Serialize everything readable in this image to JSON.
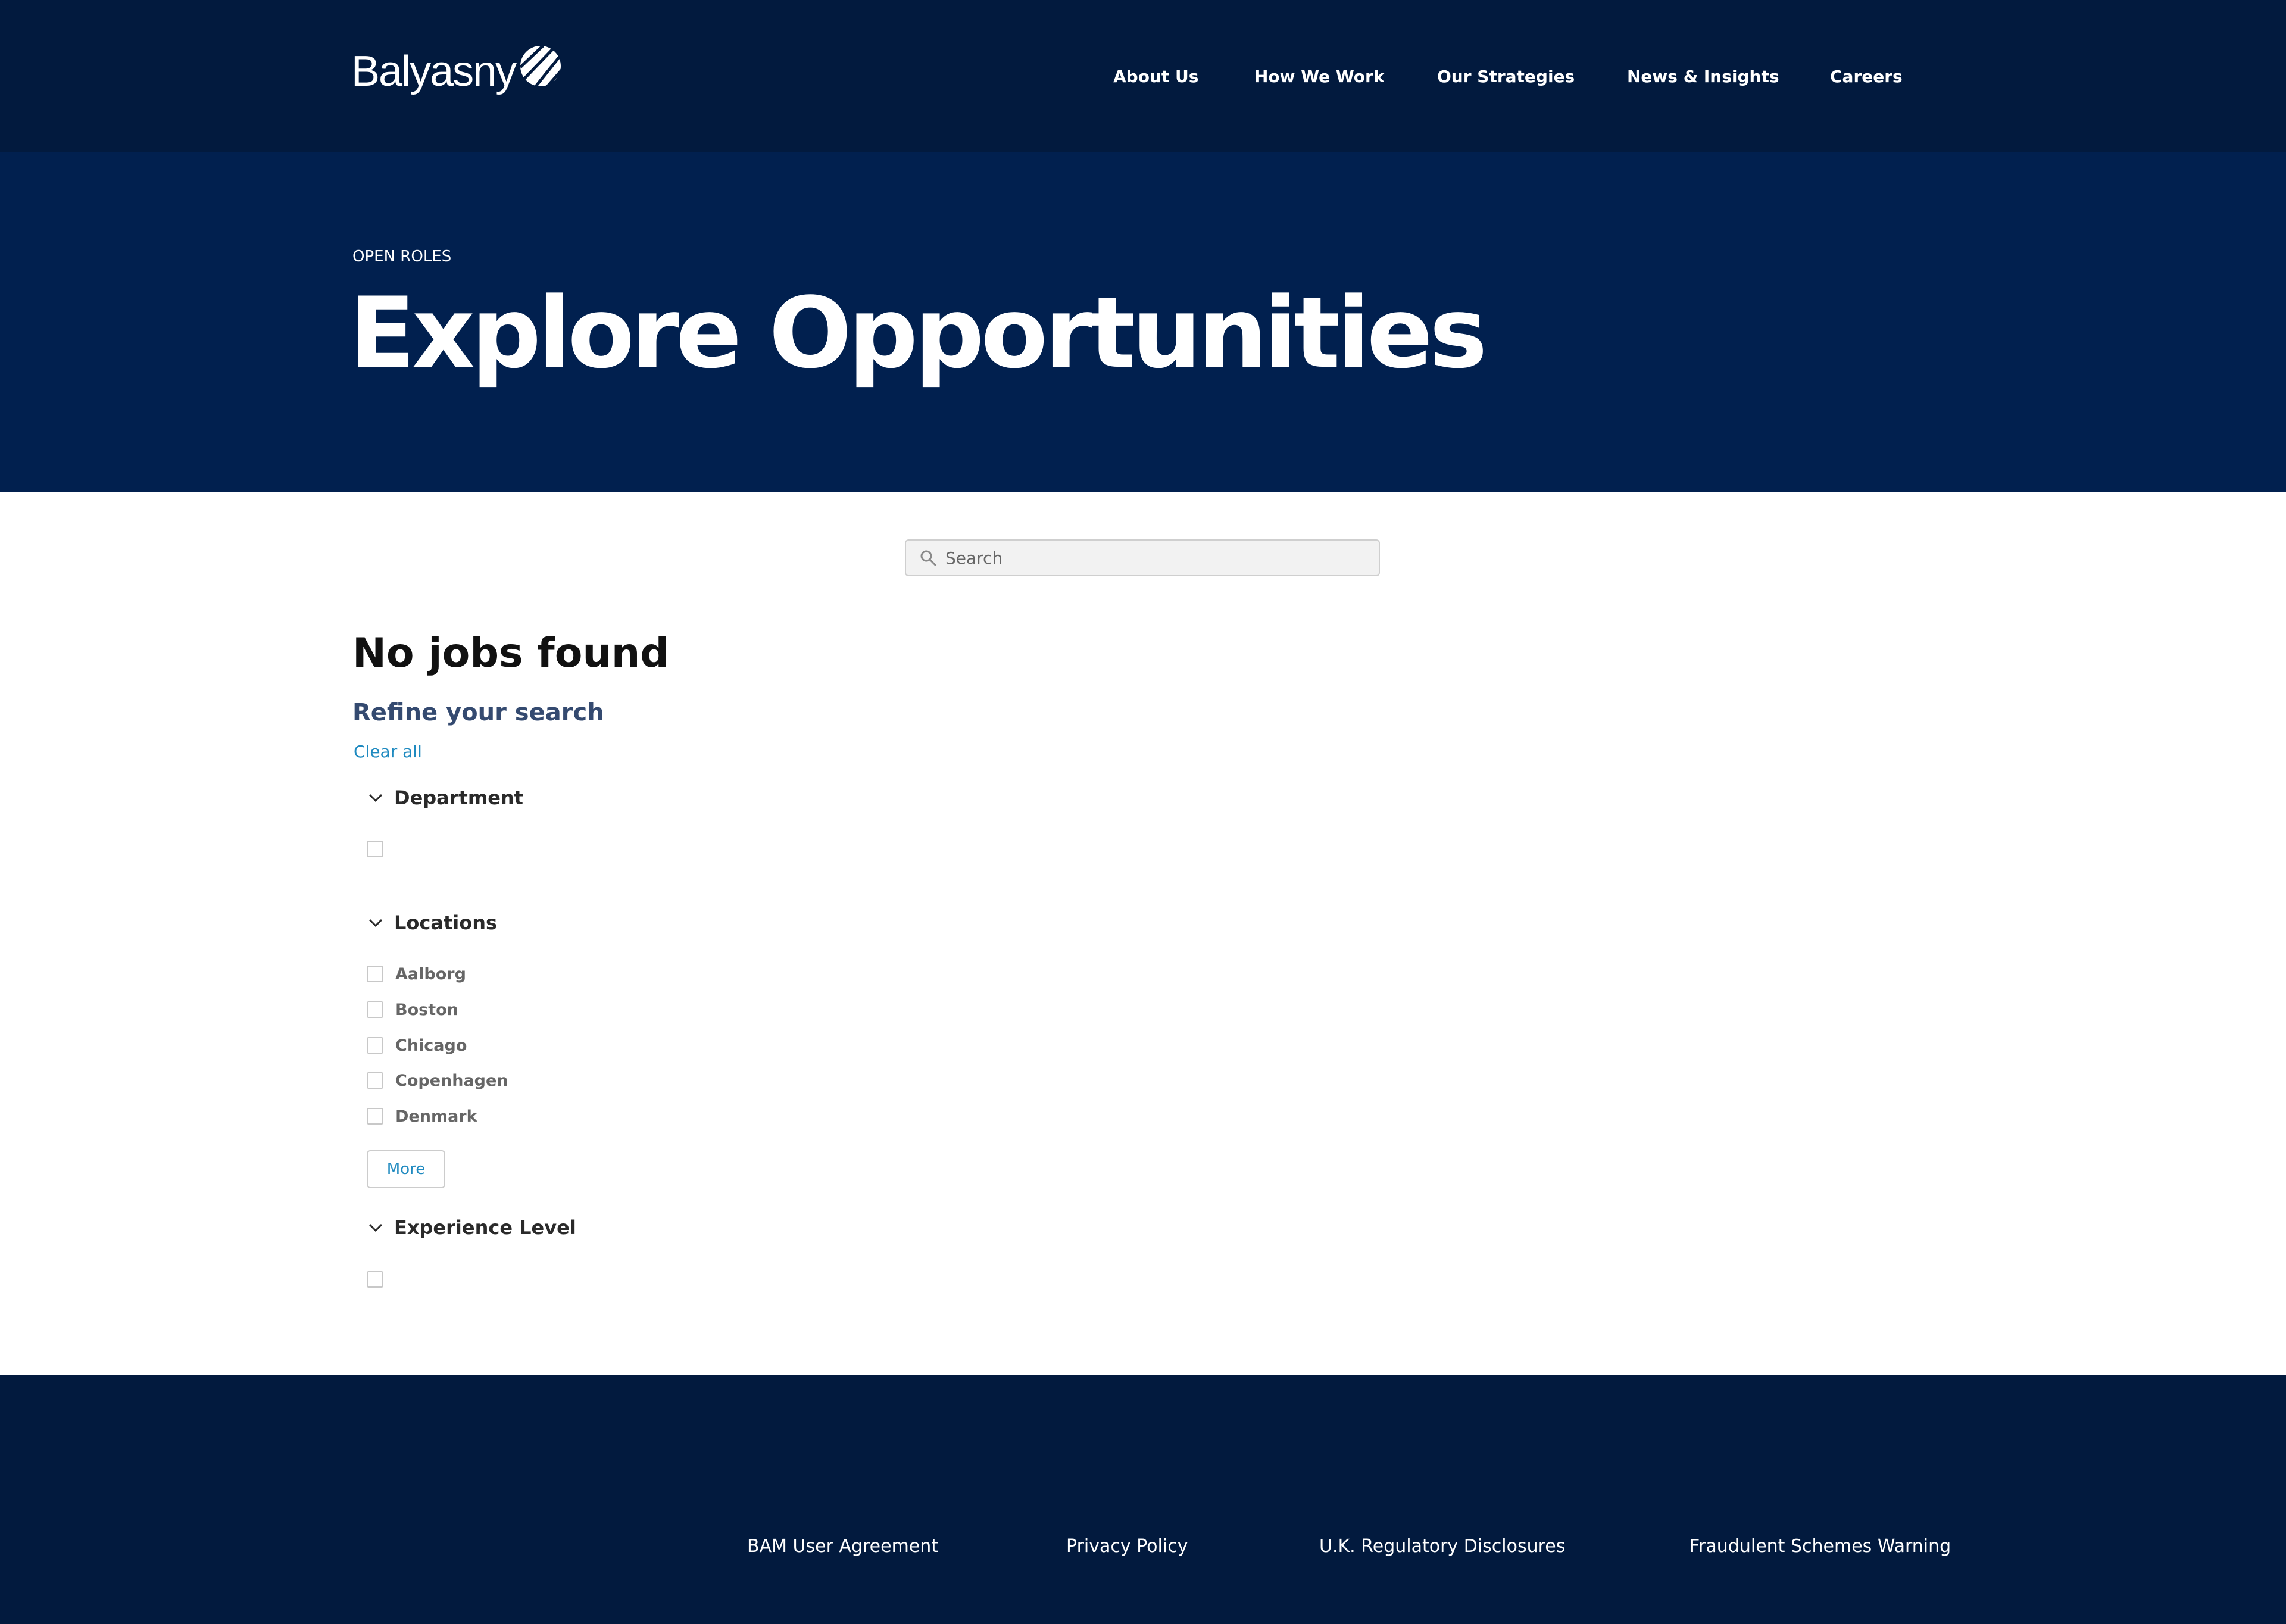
{
  "header": {
    "logo_text": "Balyasny",
    "nav": [
      "About Us",
      "How We Work",
      "Our Strategies",
      "News & Insights",
      "Careers"
    ]
  },
  "hero": {
    "eyebrow": "OPEN ROLES",
    "title": "Explore Opportunities"
  },
  "search": {
    "placeholder": "Search",
    "icon": "search-icon"
  },
  "results": {
    "heading": "No jobs found",
    "refine_label": "Refine your search",
    "clear_all": "Clear all"
  },
  "filters": {
    "department": {
      "title": "Department",
      "options": [
        ""
      ]
    },
    "locations": {
      "title": "Locations",
      "options": [
        "Aalborg",
        "Boston",
        "Chicago",
        "Copenhagen",
        "Denmark"
      ],
      "more_label": "More"
    },
    "experience": {
      "title": "Experience Level",
      "options": [
        ""
      ]
    }
  },
  "footer": {
    "links": [
      "BAM User Agreement",
      "Privacy Policy",
      "U.K. Regulatory Disclosures",
      "Fraudulent Schemes Warning"
    ]
  },
  "colors": {
    "nav_bg": "#021a3e",
    "hero_bg": "#01204f",
    "link": "#1f8ac0",
    "refine": "#344a70"
  }
}
